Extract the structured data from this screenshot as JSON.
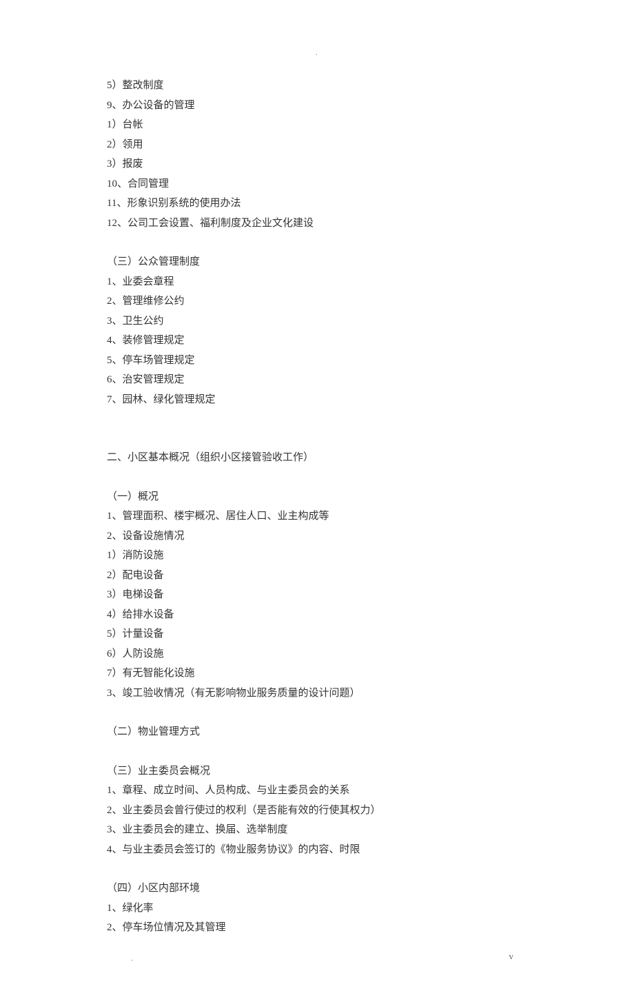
{
  "marks": {
    "dotTop": ".",
    "dotBottom": ".",
    "footerV": "v"
  },
  "lines": [
    "5）整改制度",
    "9、办公设备的管理",
    "1）台帐",
    "2）领用",
    "3）报废",
    "10、合同管理",
    "11、形象识别系统的使用办法",
    "12、公司工会设置、福利制度及企业文化建设",
    "",
    "（三）公众管理制度",
    "1、业委会章程",
    "2、管理维修公约",
    "3、卫生公约",
    "4、装修管理规定",
    "5、停车场管理规定",
    "6、治安管理规定",
    "7、园林、绿化管理规定",
    "",
    "",
    "二、小区基本概况（组织小区接管验收工作）",
    "",
    "（一）概况",
    "1、管理面积、楼宇概况、居住人口、业主构成等",
    "2、设备设施情况",
    "1）消防设施",
    "2）配电设备",
    "3）电梯设备",
    "4）给排水设备",
    "5）计量设备",
    "6）人防设施",
    "7）有无智能化设施",
    "3、竣工验收情况（有无影响物业服务质量的设计问题）",
    "",
    "（二）物业管理方式",
    "",
    "（三）业主委员会概况",
    "1、章程、成立时间、人员构成、与业主委员会的关系",
    "2、业主委员会曾行使过的权利（是否能有效的行使其权力）",
    "3、业主委员会的建立、换届、选举制度",
    "4、与业主委员会签订的《物业服务协议》的内容、时限",
    "",
    "（四）小区内部环境",
    "1、绿化率",
    "2、停车场位情况及其管理"
  ]
}
